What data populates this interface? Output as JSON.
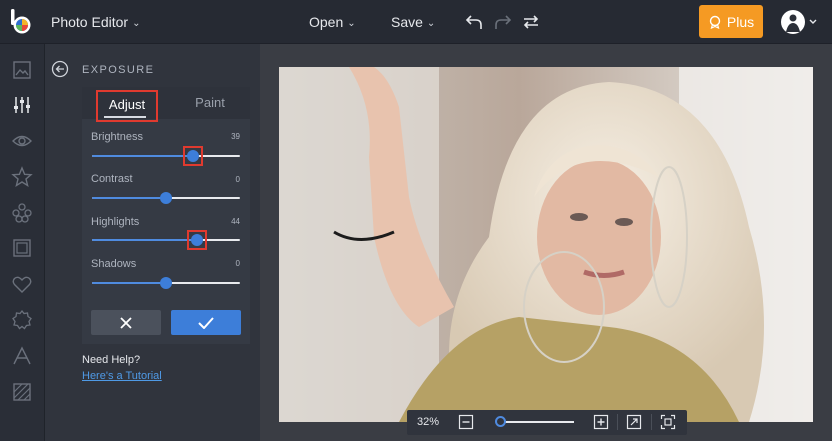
{
  "topbar": {
    "app_title": "Photo Editor",
    "open_label": "Open",
    "save_label": "Save",
    "plus_label": "Plus"
  },
  "panel": {
    "title": "EXPOSURE",
    "tabs": [
      {
        "label": "Adjust",
        "active": true
      },
      {
        "label": "Paint",
        "active": false
      }
    ],
    "sliders": [
      {
        "label": "Brightness",
        "value": "39",
        "level": 0.685
      },
      {
        "label": "Contrast",
        "value": "0",
        "level": 0.5
      },
      {
        "label": "Highlights",
        "value": "44",
        "level": 0.71
      },
      {
        "label": "Shadows",
        "value": "0",
        "level": 0.5
      }
    ],
    "help_title": "Need Help?",
    "help_link": "Here's a Tutorial"
  },
  "zoom": {
    "value": "32%",
    "level": 0.05
  },
  "colors": {
    "accent": "#3d7ed9",
    "plus": "#f59a23",
    "highlight": "#e03a2f"
  }
}
